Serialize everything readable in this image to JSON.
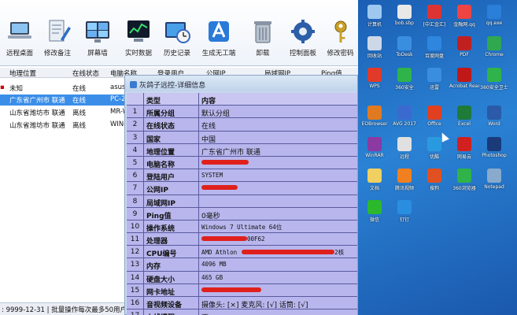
{
  "toolbar": {
    "buttons": [
      {
        "label": "远程桌面",
        "icon": "laptop-icon"
      },
      {
        "label": "修改备注",
        "icon": "edit-note-icon"
      },
      {
        "label": "屏幕墙",
        "icon": "screen-wall-icon"
      },
      {
        "label": "实时数据",
        "icon": "realtime-data-icon"
      },
      {
        "label": "历史记录",
        "icon": "history-record-icon"
      },
      {
        "label": "生成无工端",
        "icon": "generate-client-icon"
      },
      {
        "label": "卸载",
        "icon": "trash-icon"
      },
      {
        "label": "控制面板",
        "icon": "control-panel-icon"
      },
      {
        "label": "修改密码",
        "icon": "key-icon"
      }
    ]
  },
  "grid": {
    "columns": [
      "地理位置",
      "在线状态",
      "电脑名称",
      "登录用户",
      "公网IP",
      "局域网IP",
      "Ping值"
    ],
    "rows": [
      {
        "location": "未知",
        "status": "在线",
        "pc": "asus"
      },
      {
        "location": "广东省广州市 联通",
        "status": "在线",
        "pc": "PC-20"
      },
      {
        "location": "山东省潍坊市 联通",
        "status": "离线",
        "pc": "MR-WA"
      },
      {
        "location": "山东省潍坊市 联通",
        "status": "离线",
        "pc": "WIN-E"
      }
    ]
  },
  "status_bar": {
    "text": ": 9999-12-31 | 批量操作每次最多50用户"
  },
  "dialog": {
    "title": "灰鸽子远控-详细信息",
    "header": {
      "type": "类型",
      "content": "内容"
    },
    "rows": [
      {
        "n": "1",
        "type": "所属分组",
        "value": "默认分组"
      },
      {
        "n": "2",
        "type": "在线状态",
        "value": "在线"
      },
      {
        "n": "3",
        "type": "国家",
        "value": "中国"
      },
      {
        "n": "4",
        "type": "地理位置",
        "value": "广东省广州市 联通"
      },
      {
        "n": "5",
        "type": "电脑名称",
        "value": ""
      },
      {
        "n": "6",
        "type": "登陆用户",
        "value": "SYSTEM"
      },
      {
        "n": "7",
        "type": "公网IP",
        "value": ""
      },
      {
        "n": "8",
        "type": "局域网IP",
        "value": ""
      },
      {
        "n": "9",
        "type": "Ping值",
        "value": "0毫秒"
      },
      {
        "n": "10",
        "type": "操作系统",
        "value": "Windows 7 Ultimate 64位"
      },
      {
        "n": "11",
        "type": "处理器",
        "value": "00F62"
      },
      {
        "n": "12",
        "type": "CPU编号",
        "value": "AMD Athlon",
        "value_suffix": "2核"
      },
      {
        "n": "13",
        "type": "内存",
        "value": "4096 MB"
      },
      {
        "n": "14",
        "type": "硬盘大小",
        "value": "465 GB"
      },
      {
        "n": "15",
        "type": "网卡地址",
        "value": ""
      },
      {
        "n": "16",
        "type": "音视频设备",
        "value": "摄像头: [×] 麦克风: [√] 话筒: [√]"
      },
      {
        "n": "17",
        "type": "上线提醒",
        "value": "否"
      }
    ]
  },
  "desktop": {
    "icons": [
      {
        "label": "计算机",
        "color": "#9fc8f0"
      },
      {
        "label": "bob.sbp",
        "color": "#e8e8e8"
      },
      {
        "label": "[中汇金汇]",
        "color": "#d33"
      },
      {
        "label": "金融网.qq",
        "color": "#e44"
      },
      {
        "label": "qq.exe",
        "color": "#2a7fd8"
      },
      {
        "label": "回收站",
        "color": "#ccd8e8"
      },
      {
        "label": "ToDesk",
        "color": "#3a8ee0"
      },
      {
        "label": "百度网盘",
        "color": "#2e86de"
      },
      {
        "label": "PDF",
        "color": "#c02020"
      },
      {
        "label": "Chrome",
        "color": "#2fa84f"
      },
      {
        "label": "WPS",
        "color": "#e03a2a"
      },
      {
        "label": "360安全",
        "color": "#2fb34a"
      },
      {
        "label": "迅雷",
        "color": "#3a8ee0"
      },
      {
        "label": "Acrobat Reader DC",
        "color": "#c01818"
      },
      {
        "label": "360安全卫士",
        "color": "#2fb34a"
      },
      {
        "label": "EOBrowser",
        "color": "#e07a20"
      },
      {
        "label": "AVG 2017",
        "color": "#3a6ad0"
      },
      {
        "label": "Office",
        "color": "#e04020"
      },
      {
        "label": "Excel",
        "color": "#1e7b3a"
      },
      {
        "label": "Word",
        "color": "#2a5aa8"
      },
      {
        "label": "WinRAR",
        "color": "#8a3aa0"
      },
      {
        "label": "远程",
        "color": "#e0e0e0"
      },
      {
        "label": "优酷",
        "color": "#2a9ae0"
      },
      {
        "label": "网易云",
        "color": "#d02020"
      },
      {
        "label": "Photoshop",
        "color": "#1a3a7a"
      },
      {
        "label": "文档",
        "color": "#f0d060"
      },
      {
        "label": "腾讯视频",
        "color": "#f08020"
      },
      {
        "label": "搜狗",
        "color": "#e05020"
      },
      {
        "label": "360浏览器",
        "color": "#2fb34a"
      },
      {
        "label": "Notepad",
        "color": "#88aacc"
      },
      {
        "label": "微信",
        "color": "#2cb82c"
      },
      {
        "label": "钉钉",
        "color": "#2a8ee0"
      }
    ]
  }
}
